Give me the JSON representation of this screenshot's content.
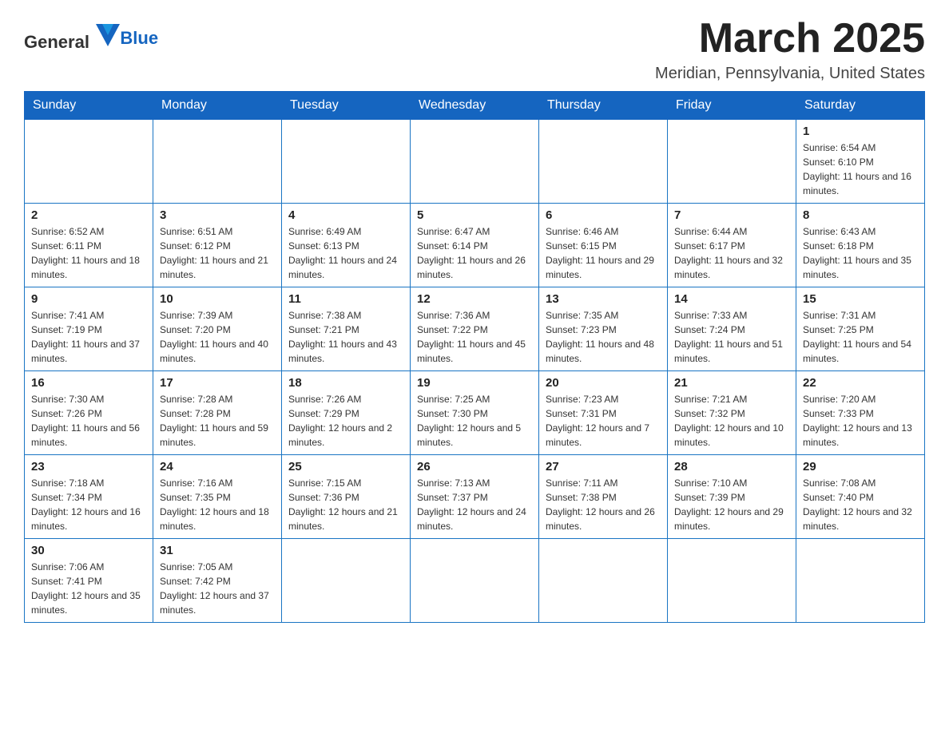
{
  "header": {
    "logo_general": "General",
    "logo_blue": "Blue",
    "month_year": "March 2025",
    "location": "Meridian, Pennsylvania, United States"
  },
  "weekdays": [
    "Sunday",
    "Monday",
    "Tuesday",
    "Wednesday",
    "Thursday",
    "Friday",
    "Saturday"
  ],
  "weeks": [
    [
      {
        "day": "",
        "sunrise": "",
        "sunset": "",
        "daylight": ""
      },
      {
        "day": "",
        "sunrise": "",
        "sunset": "",
        "daylight": ""
      },
      {
        "day": "",
        "sunrise": "",
        "sunset": "",
        "daylight": ""
      },
      {
        "day": "",
        "sunrise": "",
        "sunset": "",
        "daylight": ""
      },
      {
        "day": "",
        "sunrise": "",
        "sunset": "",
        "daylight": ""
      },
      {
        "day": "",
        "sunrise": "",
        "sunset": "",
        "daylight": ""
      },
      {
        "day": "1",
        "sunrise": "Sunrise: 6:54 AM",
        "sunset": "Sunset: 6:10 PM",
        "daylight": "Daylight: 11 hours and 16 minutes."
      }
    ],
    [
      {
        "day": "2",
        "sunrise": "Sunrise: 6:52 AM",
        "sunset": "Sunset: 6:11 PM",
        "daylight": "Daylight: 11 hours and 18 minutes."
      },
      {
        "day": "3",
        "sunrise": "Sunrise: 6:51 AM",
        "sunset": "Sunset: 6:12 PM",
        "daylight": "Daylight: 11 hours and 21 minutes."
      },
      {
        "day": "4",
        "sunrise": "Sunrise: 6:49 AM",
        "sunset": "Sunset: 6:13 PM",
        "daylight": "Daylight: 11 hours and 24 minutes."
      },
      {
        "day": "5",
        "sunrise": "Sunrise: 6:47 AM",
        "sunset": "Sunset: 6:14 PM",
        "daylight": "Daylight: 11 hours and 26 minutes."
      },
      {
        "day": "6",
        "sunrise": "Sunrise: 6:46 AM",
        "sunset": "Sunset: 6:15 PM",
        "daylight": "Daylight: 11 hours and 29 minutes."
      },
      {
        "day": "7",
        "sunrise": "Sunrise: 6:44 AM",
        "sunset": "Sunset: 6:17 PM",
        "daylight": "Daylight: 11 hours and 32 minutes."
      },
      {
        "day": "8",
        "sunrise": "Sunrise: 6:43 AM",
        "sunset": "Sunset: 6:18 PM",
        "daylight": "Daylight: 11 hours and 35 minutes."
      }
    ],
    [
      {
        "day": "9",
        "sunrise": "Sunrise: 7:41 AM",
        "sunset": "Sunset: 7:19 PM",
        "daylight": "Daylight: 11 hours and 37 minutes."
      },
      {
        "day": "10",
        "sunrise": "Sunrise: 7:39 AM",
        "sunset": "Sunset: 7:20 PM",
        "daylight": "Daylight: 11 hours and 40 minutes."
      },
      {
        "day": "11",
        "sunrise": "Sunrise: 7:38 AM",
        "sunset": "Sunset: 7:21 PM",
        "daylight": "Daylight: 11 hours and 43 minutes."
      },
      {
        "day": "12",
        "sunrise": "Sunrise: 7:36 AM",
        "sunset": "Sunset: 7:22 PM",
        "daylight": "Daylight: 11 hours and 45 minutes."
      },
      {
        "day": "13",
        "sunrise": "Sunrise: 7:35 AM",
        "sunset": "Sunset: 7:23 PM",
        "daylight": "Daylight: 11 hours and 48 minutes."
      },
      {
        "day": "14",
        "sunrise": "Sunrise: 7:33 AM",
        "sunset": "Sunset: 7:24 PM",
        "daylight": "Daylight: 11 hours and 51 minutes."
      },
      {
        "day": "15",
        "sunrise": "Sunrise: 7:31 AM",
        "sunset": "Sunset: 7:25 PM",
        "daylight": "Daylight: 11 hours and 54 minutes."
      }
    ],
    [
      {
        "day": "16",
        "sunrise": "Sunrise: 7:30 AM",
        "sunset": "Sunset: 7:26 PM",
        "daylight": "Daylight: 11 hours and 56 minutes."
      },
      {
        "day": "17",
        "sunrise": "Sunrise: 7:28 AM",
        "sunset": "Sunset: 7:28 PM",
        "daylight": "Daylight: 11 hours and 59 minutes."
      },
      {
        "day": "18",
        "sunrise": "Sunrise: 7:26 AM",
        "sunset": "Sunset: 7:29 PM",
        "daylight": "Daylight: 12 hours and 2 minutes."
      },
      {
        "day": "19",
        "sunrise": "Sunrise: 7:25 AM",
        "sunset": "Sunset: 7:30 PM",
        "daylight": "Daylight: 12 hours and 5 minutes."
      },
      {
        "day": "20",
        "sunrise": "Sunrise: 7:23 AM",
        "sunset": "Sunset: 7:31 PM",
        "daylight": "Daylight: 12 hours and 7 minutes."
      },
      {
        "day": "21",
        "sunrise": "Sunrise: 7:21 AM",
        "sunset": "Sunset: 7:32 PM",
        "daylight": "Daylight: 12 hours and 10 minutes."
      },
      {
        "day": "22",
        "sunrise": "Sunrise: 7:20 AM",
        "sunset": "Sunset: 7:33 PM",
        "daylight": "Daylight: 12 hours and 13 minutes."
      }
    ],
    [
      {
        "day": "23",
        "sunrise": "Sunrise: 7:18 AM",
        "sunset": "Sunset: 7:34 PM",
        "daylight": "Daylight: 12 hours and 16 minutes."
      },
      {
        "day": "24",
        "sunrise": "Sunrise: 7:16 AM",
        "sunset": "Sunset: 7:35 PM",
        "daylight": "Daylight: 12 hours and 18 minutes."
      },
      {
        "day": "25",
        "sunrise": "Sunrise: 7:15 AM",
        "sunset": "Sunset: 7:36 PM",
        "daylight": "Daylight: 12 hours and 21 minutes."
      },
      {
        "day": "26",
        "sunrise": "Sunrise: 7:13 AM",
        "sunset": "Sunset: 7:37 PM",
        "daylight": "Daylight: 12 hours and 24 minutes."
      },
      {
        "day": "27",
        "sunrise": "Sunrise: 7:11 AM",
        "sunset": "Sunset: 7:38 PM",
        "daylight": "Daylight: 12 hours and 26 minutes."
      },
      {
        "day": "28",
        "sunrise": "Sunrise: 7:10 AM",
        "sunset": "Sunset: 7:39 PM",
        "daylight": "Daylight: 12 hours and 29 minutes."
      },
      {
        "day": "29",
        "sunrise": "Sunrise: 7:08 AM",
        "sunset": "Sunset: 7:40 PM",
        "daylight": "Daylight: 12 hours and 32 minutes."
      }
    ],
    [
      {
        "day": "30",
        "sunrise": "Sunrise: 7:06 AM",
        "sunset": "Sunset: 7:41 PM",
        "daylight": "Daylight: 12 hours and 35 minutes."
      },
      {
        "day": "31",
        "sunrise": "Sunrise: 7:05 AM",
        "sunset": "Sunset: 7:42 PM",
        "daylight": "Daylight: 12 hours and 37 minutes."
      },
      {
        "day": "",
        "sunrise": "",
        "sunset": "",
        "daylight": ""
      },
      {
        "day": "",
        "sunrise": "",
        "sunset": "",
        "daylight": ""
      },
      {
        "day": "",
        "sunrise": "",
        "sunset": "",
        "daylight": ""
      },
      {
        "day": "",
        "sunrise": "",
        "sunset": "",
        "daylight": ""
      },
      {
        "day": "",
        "sunrise": "",
        "sunset": "",
        "daylight": ""
      }
    ]
  ]
}
